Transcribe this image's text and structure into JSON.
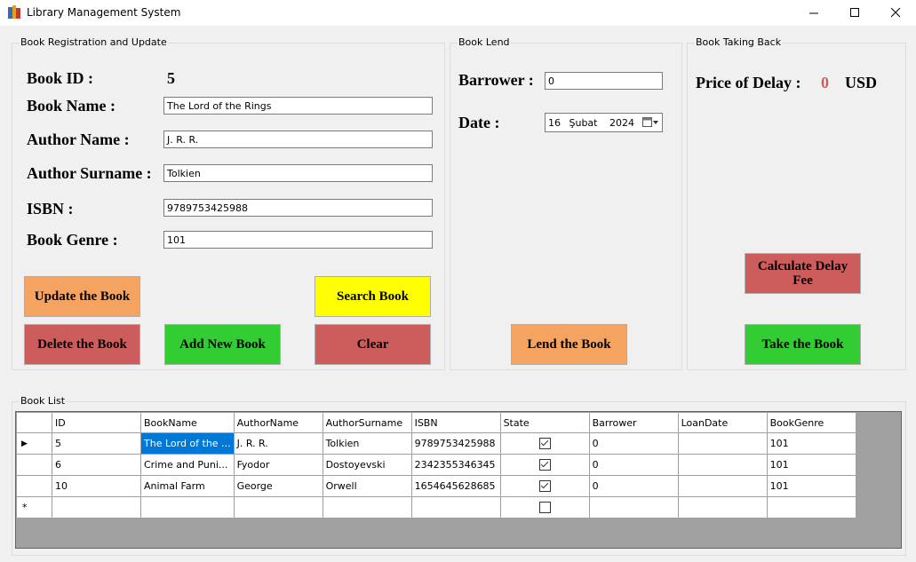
{
  "window": {
    "title": "Library Management System",
    "minimize": "—",
    "maximize": "☐",
    "close": "✕"
  },
  "registration": {
    "group_label": "Book Registration and Update",
    "book_id_label": "Book ID :",
    "book_id_value": "5",
    "book_name_label": "Book Name :",
    "book_name_value": "The Lord of the Rings",
    "author_name_label": "Author Name :",
    "author_name_value": "J. R. R.",
    "author_surname_label": "Author Surname :",
    "author_surname_value": "Tolkien",
    "isbn_label": "ISBN :",
    "isbn_value": "9789753425988",
    "genre_label": "Book Genre :",
    "genre_value": "101",
    "update_button": "Update the Book",
    "search_button": "Search Book",
    "delete_button": "Delete the Book",
    "add_button": "Add New Book",
    "clear_button": "Clear"
  },
  "lend": {
    "group_label": "Book Lend",
    "barrower_label": "Barrower :",
    "barrower_value": "0",
    "date_label": "Date :",
    "date_day": "16",
    "date_month": "Şubat",
    "date_year": "2024",
    "lend_button": "Lend the Book"
  },
  "taking_back": {
    "group_label": "Book Taking Back",
    "price_label": "Price of Delay :",
    "price_value": "0",
    "currency": "USD",
    "calculate_button": "Calculate Delay Fee",
    "take_button": "Take the Book"
  },
  "book_list": {
    "group_label": "Book List",
    "columns": [
      "ID",
      "BookName",
      "AuthorName",
      "AuthorSurname",
      "ISBN",
      "State",
      "Barrower",
      "LoanDate",
      "BookGenre"
    ],
    "rows": [
      {
        "marker": "▶",
        "id": "5",
        "name": "The Lord of the ...",
        "author": "J. R. R.",
        "surname": "Tolkien",
        "isbn": "9789753425988",
        "state": true,
        "barrower": "0",
        "loan": "",
        "genre": "101"
      },
      {
        "marker": "",
        "id": "6",
        "name": "Crime and Puni...",
        "author": "Fyodor",
        "surname": "Dostoyevski",
        "isbn": "2342355346345",
        "state": true,
        "barrower": "0",
        "loan": "",
        "genre": "101"
      },
      {
        "marker": "",
        "id": "10",
        "name": "Animal Farm",
        "author": "George",
        "surname": "Orwell",
        "isbn": "1654645628685",
        "state": true,
        "barrower": "0",
        "loan": "",
        "genre": "101"
      }
    ],
    "new_row_marker": "*"
  },
  "colors": {
    "orange": "#f4a460",
    "yellow": "#ffff00",
    "red": "#cd5c5c",
    "green": "#32cd32",
    "selection": "#0078d7"
  }
}
